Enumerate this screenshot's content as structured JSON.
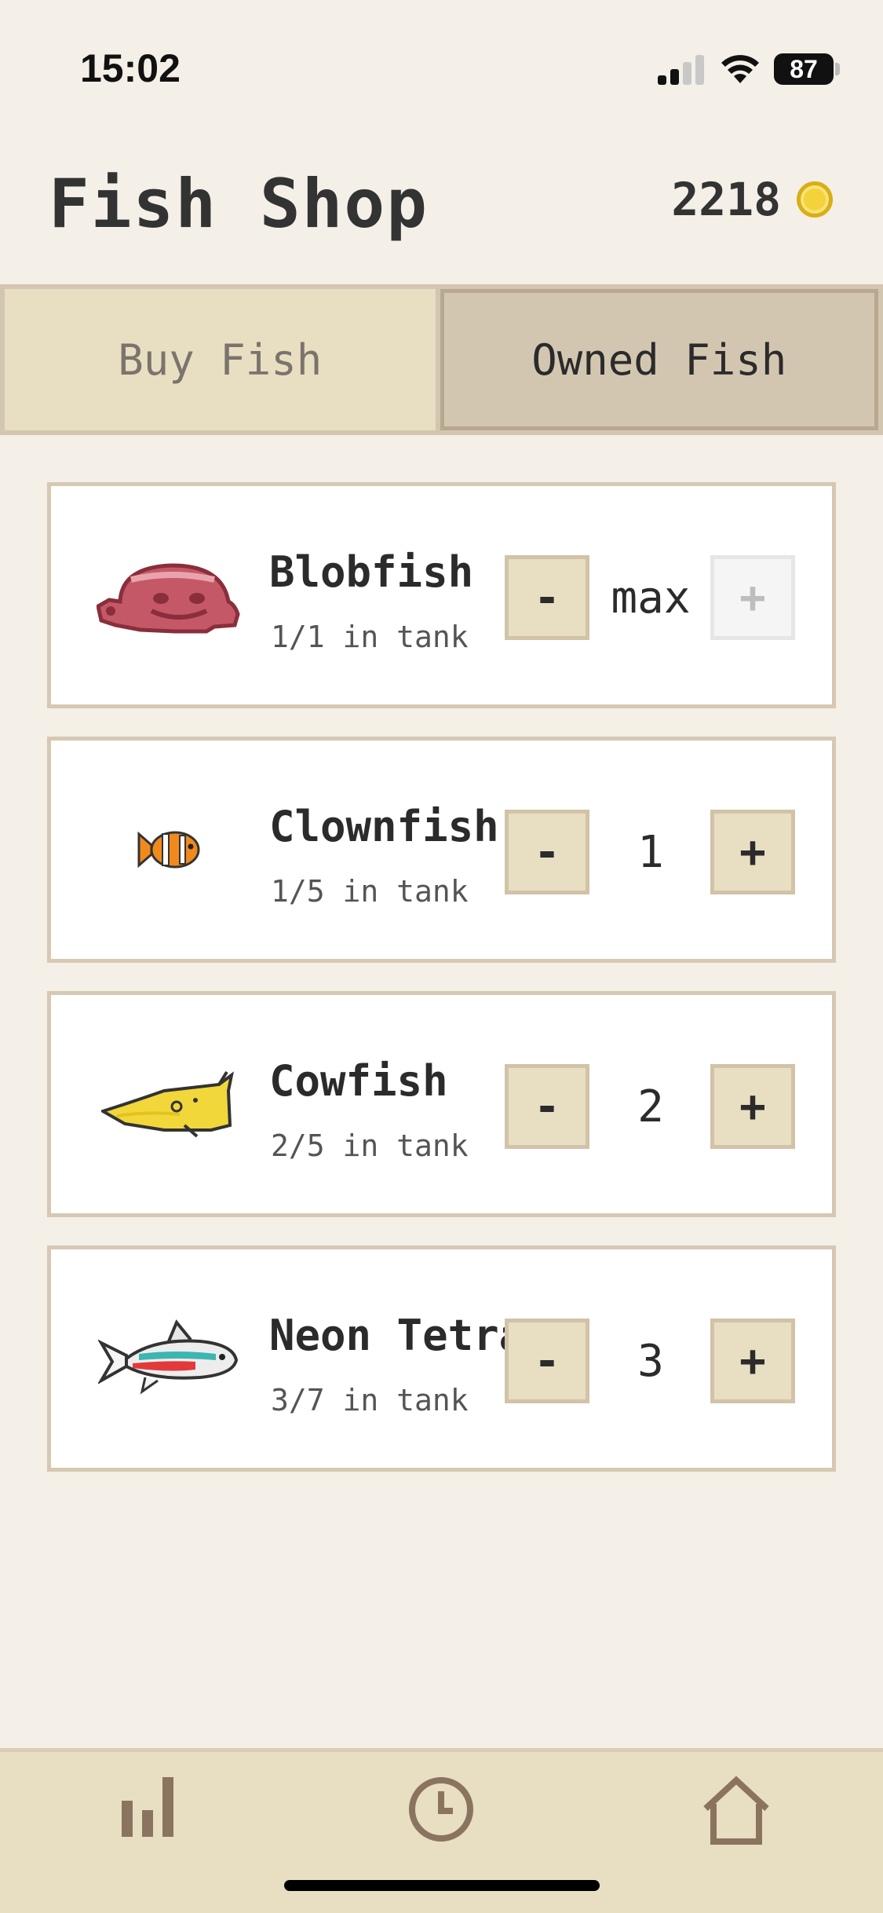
{
  "status_bar": {
    "time": "15:02",
    "battery": "87"
  },
  "header": {
    "title": "Fish Shop",
    "coins": "2218"
  },
  "tabs": [
    {
      "label": "Buy Fish",
      "active": false
    },
    {
      "label": "Owned Fish",
      "active": true
    }
  ],
  "fish": [
    {
      "name": "Blobfish",
      "count": "1/1 in tank",
      "quantity": "max",
      "minus": "-",
      "plus": "+",
      "plus_disabled": true,
      "icon": "blobfish-icon"
    },
    {
      "name": "Clownfish",
      "count": "1/5 in tank",
      "quantity": "1",
      "minus": "-",
      "plus": "+",
      "plus_disabled": false,
      "icon": "clownfish-icon"
    },
    {
      "name": "Cowfish",
      "count": "2/5 in tank",
      "quantity": "2",
      "minus": "-",
      "plus": "+",
      "plus_disabled": false,
      "icon": "cowfish-icon"
    },
    {
      "name": "Neon Tetra",
      "count": "3/7 in tank",
      "quantity": "3",
      "minus": "-",
      "plus": "+",
      "plus_disabled": false,
      "icon": "neon-tetra-icon"
    }
  ],
  "nav": {
    "items": [
      {
        "icon": "bar-chart-icon"
      },
      {
        "icon": "clock-icon"
      },
      {
        "icon": "home-icon"
      }
    ]
  },
  "colors": {
    "background": "#f4efe7",
    "panel": "#e8dec2",
    "border": "#d6c8b2",
    "text": "#2b2b2b",
    "nav_icon": "#8a7460",
    "coin": "#f3d23a"
  }
}
